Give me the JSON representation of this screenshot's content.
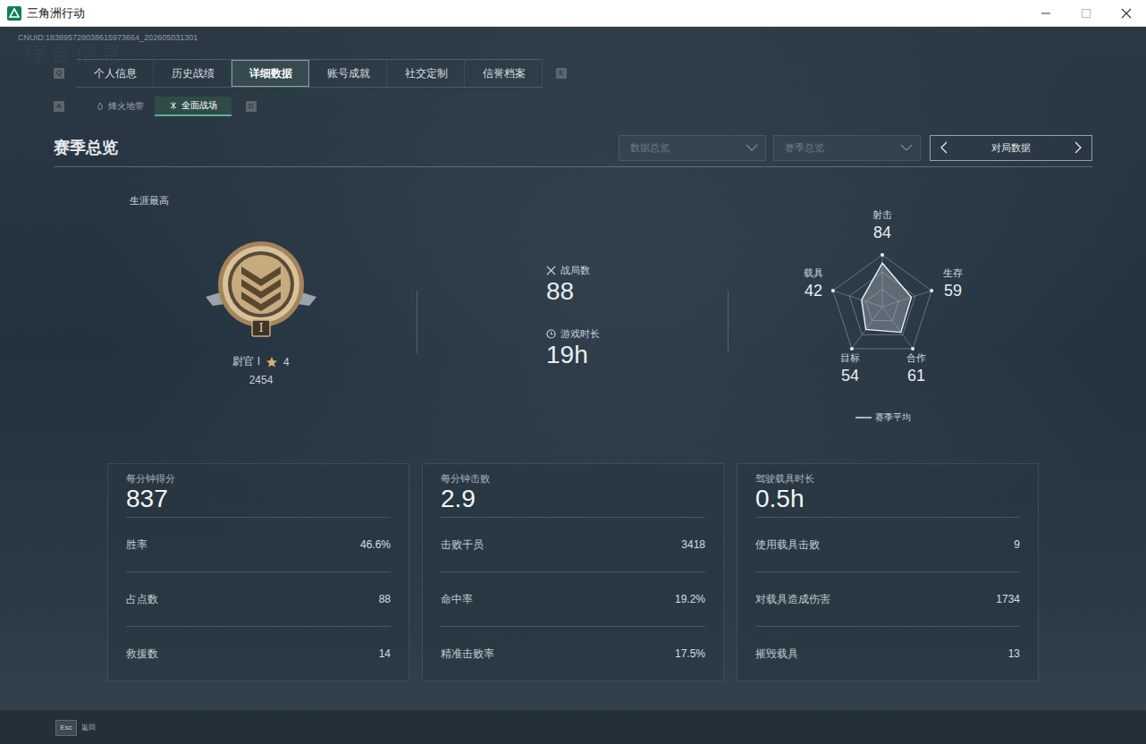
{
  "window": {
    "title": "三角洲行动"
  },
  "uid": "CNUID:183895728038615973664_202605031301",
  "watermark": "综合信息",
  "tabs": {
    "prev_key": "Q",
    "next_key": "E",
    "items": [
      {
        "label": "个人信息",
        "selected": false
      },
      {
        "label": "历史战绩",
        "selected": false
      },
      {
        "label": "详细数据",
        "selected": true
      },
      {
        "label": "账号成就",
        "selected": false
      },
      {
        "label": "社交定制",
        "selected": false
      },
      {
        "label": "信誉档案",
        "selected": false
      }
    ]
  },
  "mode_tabs": {
    "prev_key": "A",
    "next_key": "D",
    "items": [
      {
        "label": "烽火地带",
        "selected": false
      },
      {
        "label": "全面战场",
        "selected": true
      }
    ]
  },
  "section": {
    "title": "赛季总览",
    "filters": [
      "数据总览",
      "赛季总览"
    ],
    "pager": "对局数据"
  },
  "career": {
    "label": "生涯最高",
    "badge_numeral": "I",
    "rank": "尉官 I",
    "star_count": "4",
    "score": "2454"
  },
  "summary": [
    {
      "kind": "matches",
      "label": "战局数",
      "value": "88"
    },
    {
      "kind": "time",
      "label": "游戏时长",
      "value": "19h"
    }
  ],
  "radar": {
    "axes": [
      {
        "label": "射击",
        "value": "84"
      },
      {
        "label": "生存",
        "value": "59"
      },
      {
        "label": "合作",
        "value": "61"
      },
      {
        "label": "目标",
        "value": "54"
      },
      {
        "label": "载具",
        "value": "42"
      }
    ],
    "series": {
      "label": "赛季平均",
      "values": [
        84,
        59,
        61,
        54,
        42
      ]
    }
  },
  "cards": [
    {
      "title": "每分钟得分",
      "value": "837",
      "rows": [
        {
          "label": "胜率",
          "value": "46.6%"
        },
        {
          "label": "占点数",
          "value": "88"
        },
        {
          "label": "救援数",
          "value": "14"
        }
      ]
    },
    {
      "title": "每分钟击败",
      "value": "2.9",
      "rows": [
        {
          "label": "击败干员",
          "value": "3418"
        },
        {
          "label": "命中率",
          "value": "19.2%"
        },
        {
          "label": "精准击败率",
          "value": "17.5%"
        }
      ]
    },
    {
      "title": "驾驶载具时长",
      "value": "0.5h",
      "rows": [
        {
          "label": "使用载具击败",
          "value": "9"
        },
        {
          "label": "对载具造成伤害",
          "value": "1734"
        },
        {
          "label": "摧毁载具",
          "value": "13"
        }
      ]
    }
  ],
  "footer": {
    "key": "Esc",
    "label": "返回"
  }
}
